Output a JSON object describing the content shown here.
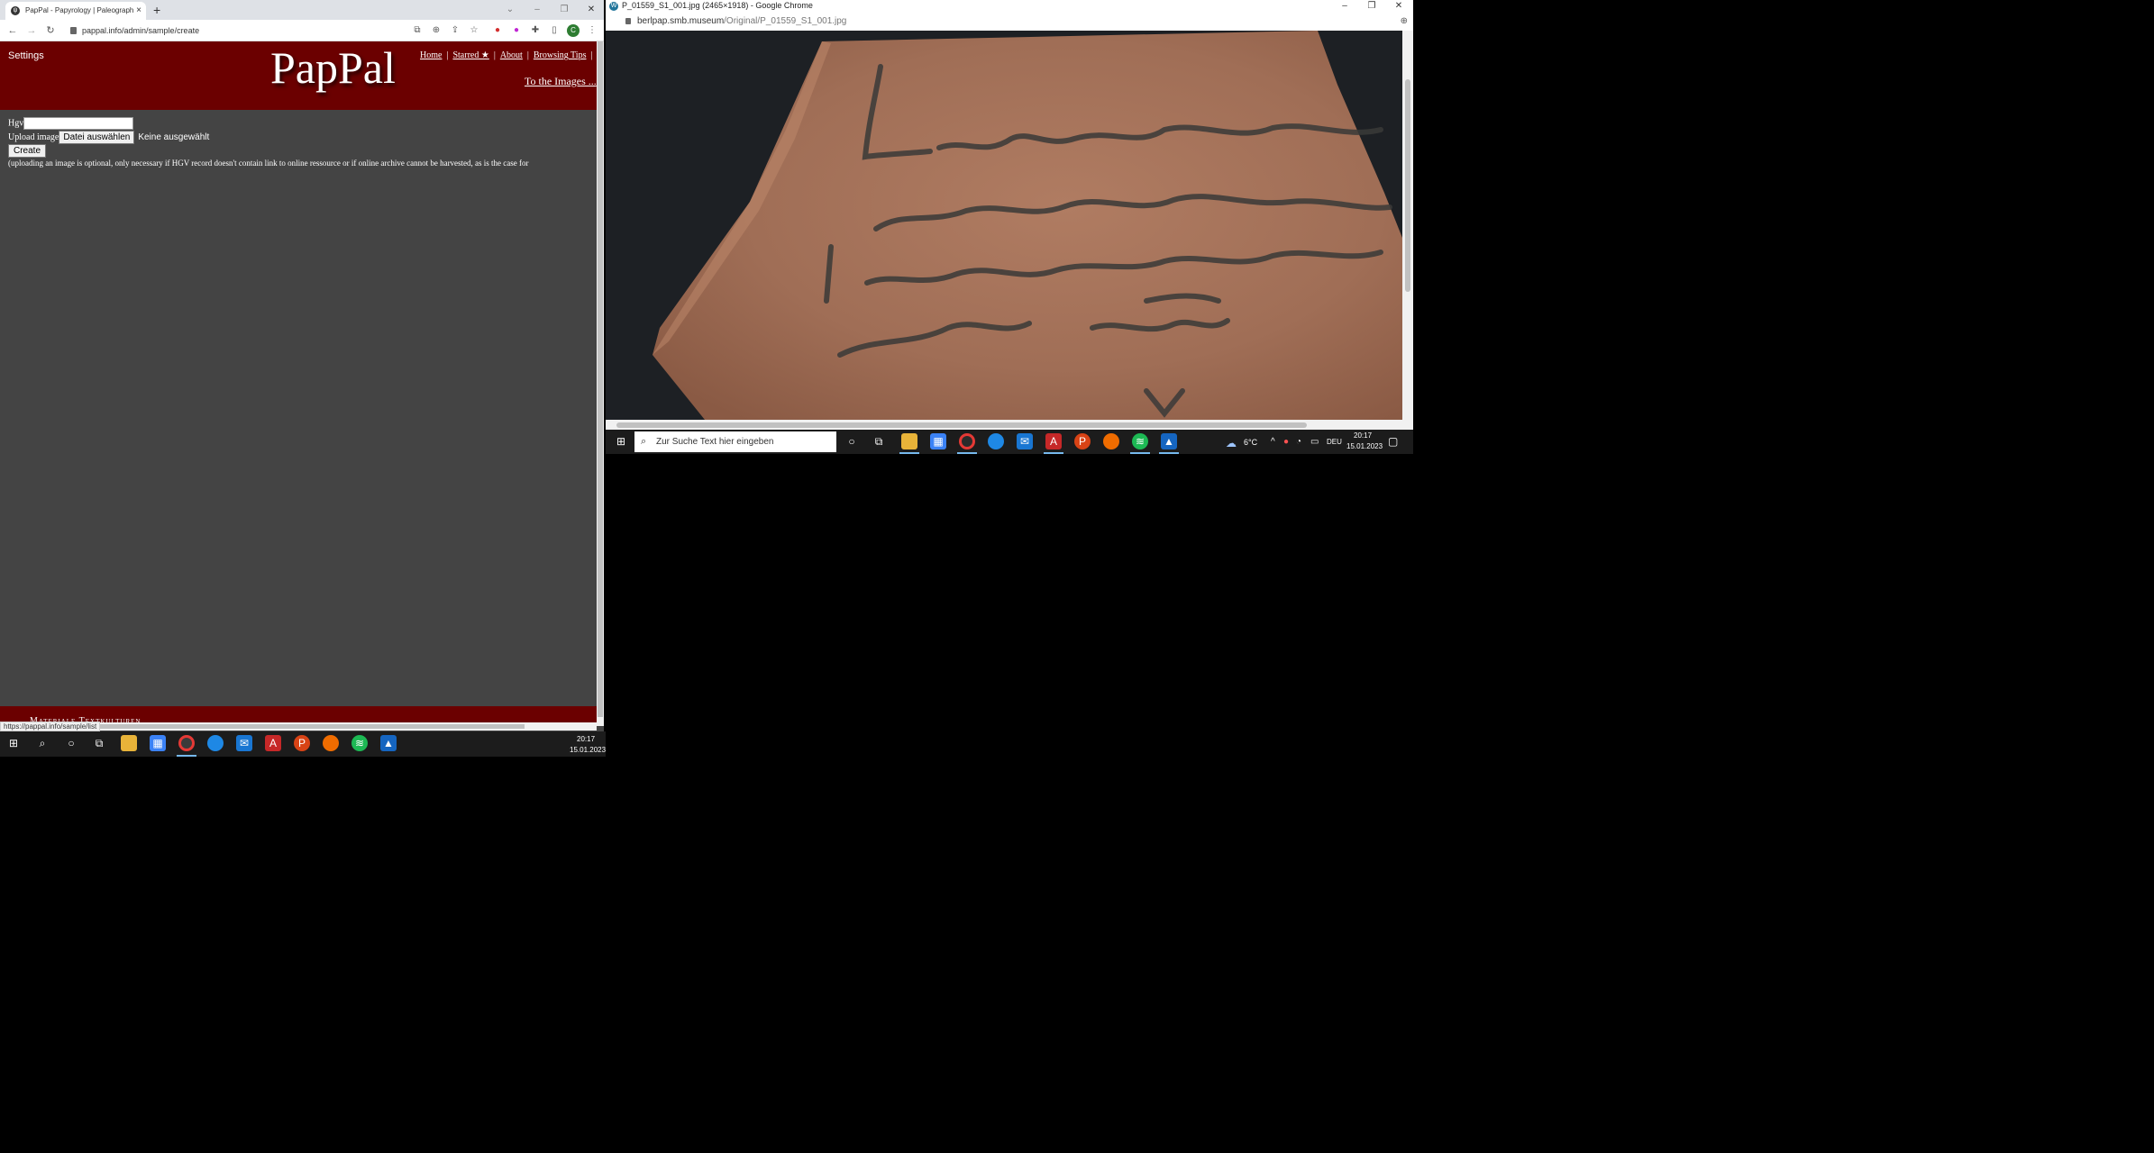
{
  "left_window": {
    "tab_title": "PapPal - Papyrology | Paleograph",
    "tab_close": "×",
    "new_tab": "+",
    "url": "pappal.info/admin/sample/create",
    "profile_initial": "C",
    "status_url": "https://pappal.info/sample/list"
  },
  "site": {
    "settings": "Settings",
    "logo": "PapPal",
    "nav": [
      "Home",
      "Starred ★",
      "About",
      "Browsing Tips"
    ],
    "nav_tail": "|",
    "to_images": "To the Images ..."
  },
  "form": {
    "hgv_label": "Hgv",
    "hgv_value": "",
    "upload_label": "Upload image",
    "file_button": "Datei auswählen",
    "file_none": "Keine ausgewählt",
    "create_button": "Create",
    "note": "(uploading an image is optional, only necessary if HGV record doesn't contain link to online ressource or if online archive cannot be harvested, as is the case for"
  },
  "footer": {
    "text": "Materiale Textkulturen"
  },
  "right_window": {
    "title": "P_01559_S1_001.jpg (2465×1918) - Google Chrome",
    "url_host": "berlpap.smb.museum",
    "url_path": "/Original/P_01559_S1_001.jpg",
    "image_subject": "ostracon with ink handwriting"
  },
  "taskbar_right": {
    "search_placeholder": "Zur Suche Text hier eingeben",
    "weather": "6°C",
    "lang": "DEU",
    "time": "20:17",
    "date": "15.01.2023"
  },
  "taskbar_left": {
    "time": "20:17",
    "date": "15.01.2023"
  },
  "colors": {
    "header_bg": "#6b0000",
    "page_bg": "#444444",
    "taskbar_bg": "#1c1c1c"
  }
}
